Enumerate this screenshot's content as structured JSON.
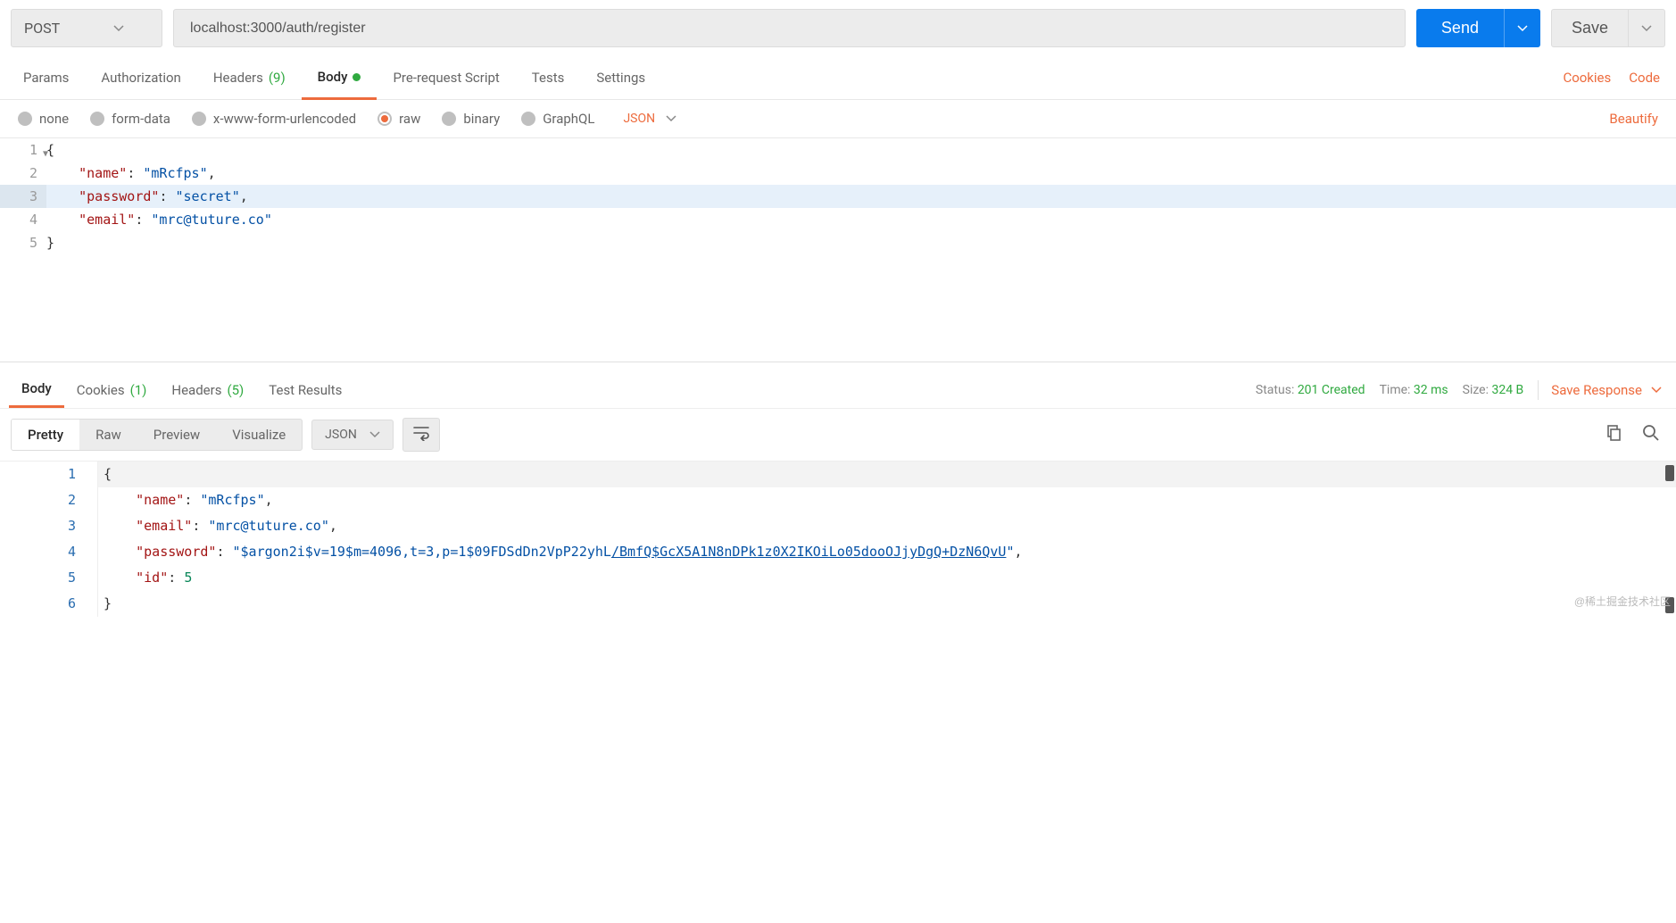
{
  "request": {
    "method": "POST",
    "url": "localhost:3000/auth/register",
    "send_label": "Send",
    "save_label": "Save"
  },
  "req_tabs": {
    "params": "Params",
    "authorization": "Authorization",
    "headers": "Headers",
    "headers_count": "(9)",
    "body": "Body",
    "prerequest": "Pre-request Script",
    "tests": "Tests",
    "settings": "Settings",
    "cookies_link": "Cookies",
    "code_link": "Code"
  },
  "body_types": {
    "none": "none",
    "formdata": "form-data",
    "urlencoded": "x-www-form-urlencoded",
    "raw": "raw",
    "binary": "binary",
    "graphql": "GraphQL",
    "lang": "JSON",
    "beautify": "Beautify"
  },
  "req_body_lines": [
    {
      "n": "1",
      "html": "<span class='tok-pun'>{</span>",
      "fold": true
    },
    {
      "n": "2",
      "html": "    <span class='tok-key'>\"name\"</span><span class='tok-pun'>: </span><span class='tok-str'>\"mRcfps\"</span><span class='tok-pun'>,</span>"
    },
    {
      "n": "3",
      "html": "    <span class='tok-key'>\"password\"</span><span class='tok-pun'>: </span><span class='tok-str'>\"secret\"</span><span class='tok-pun'>,</span>",
      "hl": true
    },
    {
      "n": "4",
      "html": "    <span class='tok-key'>\"email\"</span><span class='tok-pun'>: </span><span class='tok-str'>\"mrc@tuture.co\"</span>"
    },
    {
      "n": "5",
      "html": "<span class='tok-pun'>}</span>"
    }
  ],
  "resp_tabs": {
    "body": "Body",
    "cookies": "Cookies",
    "cookies_count": "(1)",
    "headers": "Headers",
    "headers_count": "(5)",
    "test_results": "Test Results"
  },
  "resp_meta": {
    "status_label": "Status:",
    "status_value": "201 Created",
    "time_label": "Time:",
    "time_value": "32 ms",
    "size_label": "Size:",
    "size_value": "324 B",
    "save_response": "Save Response"
  },
  "viewer": {
    "pretty": "Pretty",
    "raw": "Raw",
    "preview": "Preview",
    "visualize": "Visualize",
    "lang": "JSON"
  },
  "resp_body_lines": [
    {
      "n": "1",
      "html": "<span class='tok-pun'>{</span>",
      "first": true
    },
    {
      "n": "2",
      "html": "    <span class='r-key'>\"name\"</span><span class='tok-pun'>: </span><span class='r-str'>\"mRcfps\"</span><span class='tok-pun'>,</span>"
    },
    {
      "n": "3",
      "html": "    <span class='r-key'>\"email\"</span><span class='tok-pun'>: </span><span class='r-str'>\"mrc@tuture.co\"</span><span class='tok-pun'>,</span>"
    },
    {
      "n": "4",
      "html": "    <span class='r-key'>\"password\"</span><span class='tok-pun'>: </span><span class='r-str'>\"$argon2i$v=19$m=4096,t=3,p=1$09FDSdDn2VpP22yhL<span class='underline'>/BmfQ$GcX5A1N8nDPk1z0X2IKOiLo05dooOJjyDgQ+DzN6QvU</span>\"</span><span class='tok-pun'>,</span>"
    },
    {
      "n": "5",
      "html": "    <span class='r-key'>\"id\"</span><span class='tok-pun'>: </span><span class='r-num'>5</span>"
    },
    {
      "n": "6",
      "html": "<span class='tok-pun'>}</span>"
    }
  ],
  "watermark": "@稀土掘金技术社区"
}
